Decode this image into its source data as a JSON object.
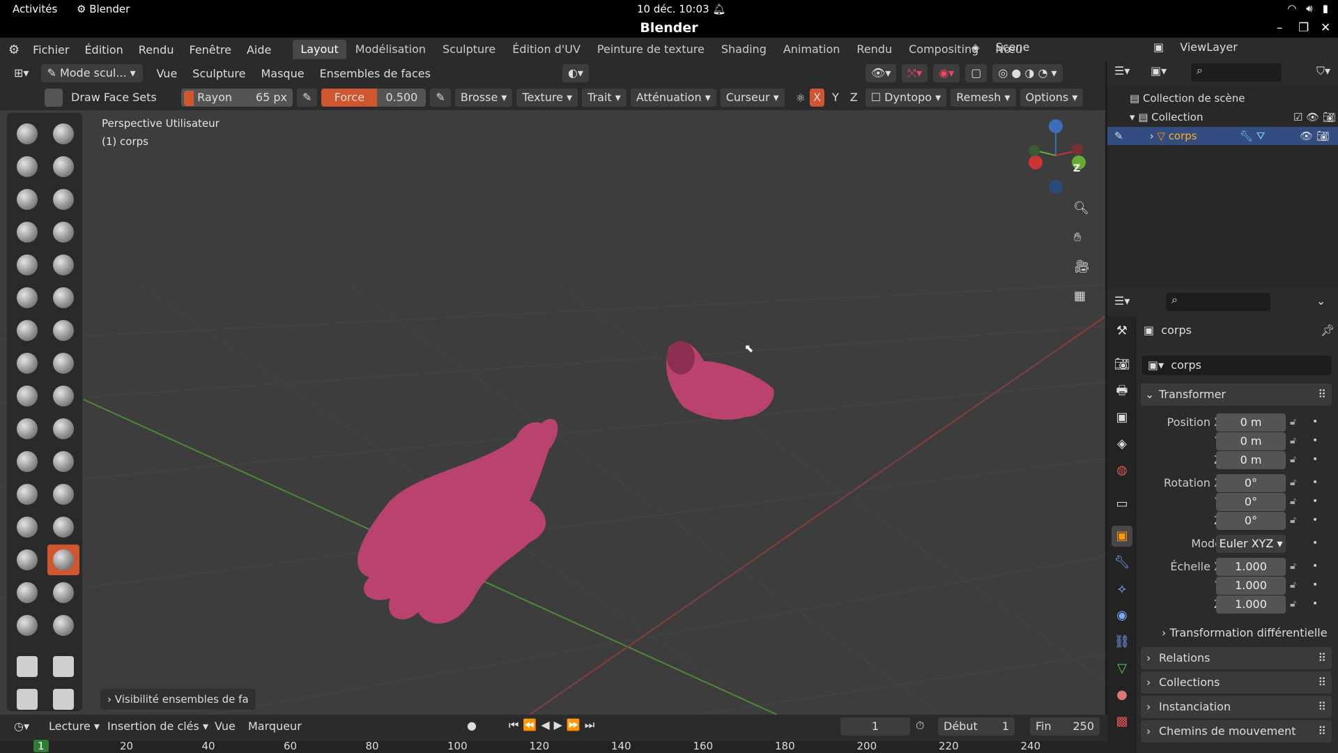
{
  "gnome": {
    "activities": "Activités",
    "app": "Blender",
    "clock": "10 déc.  10:03"
  },
  "window": {
    "title": "Blender"
  },
  "menu": [
    "Fichier",
    "Édition",
    "Rendu",
    "Fenêtre",
    "Aide"
  ],
  "workspaces": [
    {
      "label": "Layout",
      "active": true
    },
    {
      "label": "Modélisation"
    },
    {
      "label": "Sculpture"
    },
    {
      "label": "Édition d'UV"
    },
    {
      "label": "Peinture de texture"
    },
    {
      "label": "Shading"
    },
    {
      "label": "Animation"
    },
    {
      "label": "Rendu"
    },
    {
      "label": "Compositing"
    },
    {
      "label": "Nœu"
    }
  ],
  "scene": {
    "name": "Scene",
    "viewlayer": "ViewLayer"
  },
  "header": {
    "mode": "Mode scul...",
    "menus": [
      "Vue",
      "Sculpture",
      "Masque",
      "Ensembles de faces"
    ]
  },
  "toolset": {
    "brush": "Draw Face Sets",
    "radius_label": "Rayon",
    "radius_value": "65 px",
    "force_label": "Force",
    "force_value": "0.500",
    "dropdowns": [
      "Brosse",
      "Texture",
      "Trait",
      "Atténuation",
      "Curseur"
    ],
    "axes": [
      "X",
      "Y",
      "Z"
    ],
    "dyntopo": "Dyntopo",
    "remesh": "Remesh",
    "options": "Options"
  },
  "viewport": {
    "view_name": "Perspective Utilisateur",
    "object": "(1) corps",
    "panel": "Visibilité ensembles de fa",
    "accent": "#b9426f"
  },
  "outliner": {
    "root": "Collection de scène",
    "collection": "Collection",
    "object": "corps"
  },
  "properties": {
    "object_name": "corps",
    "data_name": "corps",
    "transform": "Transformer",
    "position_label": "Position X",
    "position": [
      "0 m",
      "0 m",
      "0 m"
    ],
    "rotation_label": "Rotation X",
    "rotation": [
      "0°",
      "0°",
      "0°"
    ],
    "mode_label": "Mode",
    "mode": "Euler XYZ",
    "scale_label": "Échelle X",
    "scale": [
      "1.000",
      "1.000",
      "1.000"
    ],
    "delta": "Transformation différentielle",
    "panels": [
      "Relations",
      "Collections",
      "Instanciation",
      "Chemins de mouvement"
    ]
  },
  "timeline": {
    "menus": [
      "Lecture",
      "Insertion de clés",
      "Vue",
      "Marqueur"
    ],
    "current": "1",
    "start_label": "Début",
    "start": "1",
    "end_label": "Fin",
    "end": "250",
    "ruler": [
      "1",
      "20",
      "40",
      "60",
      "80",
      "100",
      "120",
      "140",
      "160",
      "180",
      "200",
      "220",
      "240"
    ]
  }
}
